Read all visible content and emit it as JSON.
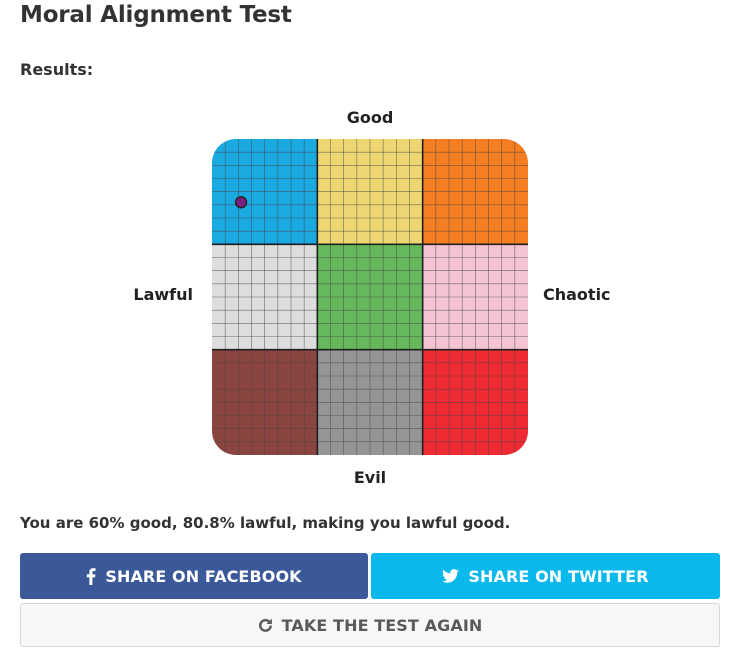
{
  "page": {
    "title": "Moral Alignment Test",
    "subheading": "Results:"
  },
  "chart": {
    "axes": {
      "top": "Good",
      "bottom": "Evil",
      "left": "Lawful",
      "right": "Chaotic"
    },
    "cell_colors": [
      [
        "#1aa9e0",
        "#eed773",
        "#f57d22"
      ],
      [
        "#dddddd",
        "#66b85c",
        "#f4c4d2"
      ],
      [
        "#8b4541",
        "#959595",
        "#ee2a33"
      ]
    ],
    "grid_line_color": "#444444",
    "subgrid_divisions": 8,
    "marker_color": "#7a1f7f",
    "marker_border_color": "#222222"
  },
  "chart_data": {
    "type": "scatter",
    "axes": {
      "top": "Good",
      "bottom": "Evil",
      "left": "Lawful",
      "right": "Chaotic"
    },
    "good_percent": 60,
    "lawful_percent": 80.8,
    "alignment": "lawful good",
    "marker": {
      "x_chaotic_percent": 9.2,
      "y_good_percent": 80
    }
  },
  "result": {
    "text": "You are 60% good, 80.8% lawful, making you lawful good."
  },
  "buttons": {
    "facebook": {
      "label": "SHARE ON FACEBOOK",
      "icon": "facebook-icon",
      "color": "#3b5998"
    },
    "twitter": {
      "label": "SHARE ON TWITTER",
      "icon": "twitter-icon",
      "color": "#0ab9ec"
    },
    "again": {
      "label": "TAKE THE TEST AGAIN",
      "icon": "refresh-icon"
    }
  }
}
